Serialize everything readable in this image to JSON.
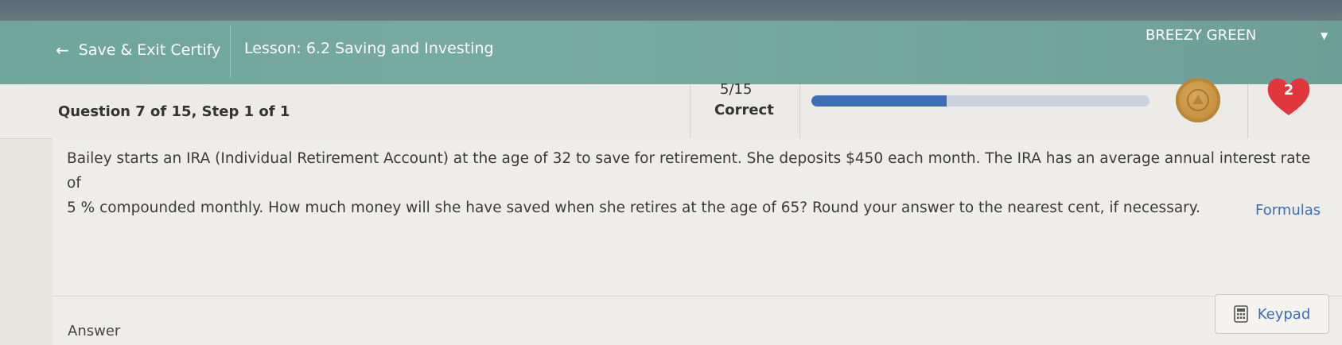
{
  "header": {
    "back_label": "Save & Exit Certify",
    "lesson_title": "Lesson: 6.2 Saving and Investing",
    "user_name": "BREEZY GREEN"
  },
  "question_bar": {
    "title": "Question 7 of 15, Step 1 of 1",
    "score": "5/15",
    "score_label": "Correct",
    "progress_fraction": 0.4,
    "lives": "2"
  },
  "question": {
    "text_line1": "Bailey starts an IRA (Individual Retirement Account) at the age of 32 to save for retirement. She deposits $450 each month. The IRA has an average annual interest rate of",
    "text_line2": "5 % compounded monthly. How much money will she have saved when she retires at the age of 65? Round your answer to the nearest cent, if necessary.",
    "formulas_label": "Formulas"
  },
  "answer": {
    "label": "Answer",
    "keypad_label": "Keypad"
  },
  "colors": {
    "header_bg": "#6fa59d",
    "progress_fill": "#3f6db5",
    "link": "#3d6db3",
    "heart": "#e0363c"
  }
}
